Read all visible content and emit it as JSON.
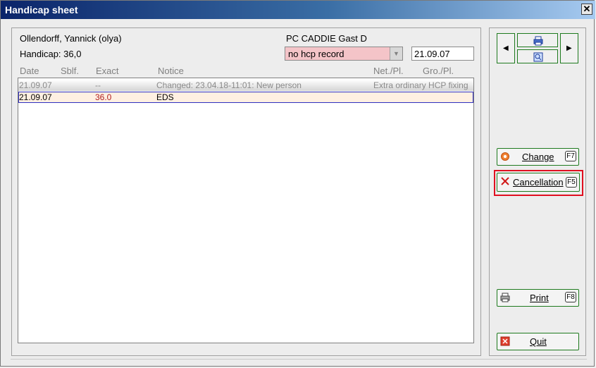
{
  "window": {
    "title": "Handicap sheet",
    "close_label": "✕"
  },
  "person": {
    "name": "Ollendorff, Yannick (olya)",
    "handicap": "Handicap: 36,0"
  },
  "club": {
    "label": "PC CADDIE Gast D"
  },
  "record_select": {
    "value": "no hcp record"
  },
  "date_field": {
    "value": "21.09.07"
  },
  "table": {
    "columns": [
      "Date",
      "Sblf.",
      "Exact",
      "Notice",
      "Net./Pl.",
      "Gro./Pl."
    ],
    "rows": [
      {
        "date": "21.09.07",
        "sblf": "",
        "exact": "--",
        "notice": "Changed: 23.04.18-11:01: New person",
        "net": "Extra ordinary HCP fixing",
        "gro": ""
      },
      {
        "date": "21.09.07",
        "sblf": "",
        "exact": "36.0",
        "notice": "EDS",
        "net": "",
        "gro": ""
      }
    ]
  },
  "buttons": {
    "change": {
      "label": "Change",
      "key": "F7"
    },
    "cancellation": {
      "label": "Cancellation",
      "key": "F5"
    },
    "print": {
      "label": "Print",
      "key": "F8"
    },
    "quit": {
      "label": "Quit"
    }
  },
  "icons": {
    "prev": "triangle-left-icon",
    "next": "triangle-right-icon",
    "printer_small": "printer-icon",
    "search_small": "search-icon",
    "change": "target-icon",
    "cancellation": "x-icon",
    "print": "printer-icon",
    "quit": "close-icon"
  },
  "colors": {
    "title_bar_start": "#0a246a",
    "dropdown_bg": "#f4c4c8",
    "selected_row_bg": "#fff0e2",
    "highlight_border": "#e01020",
    "button_border": "#1e7a1e",
    "exact_value": "#b02020"
  }
}
